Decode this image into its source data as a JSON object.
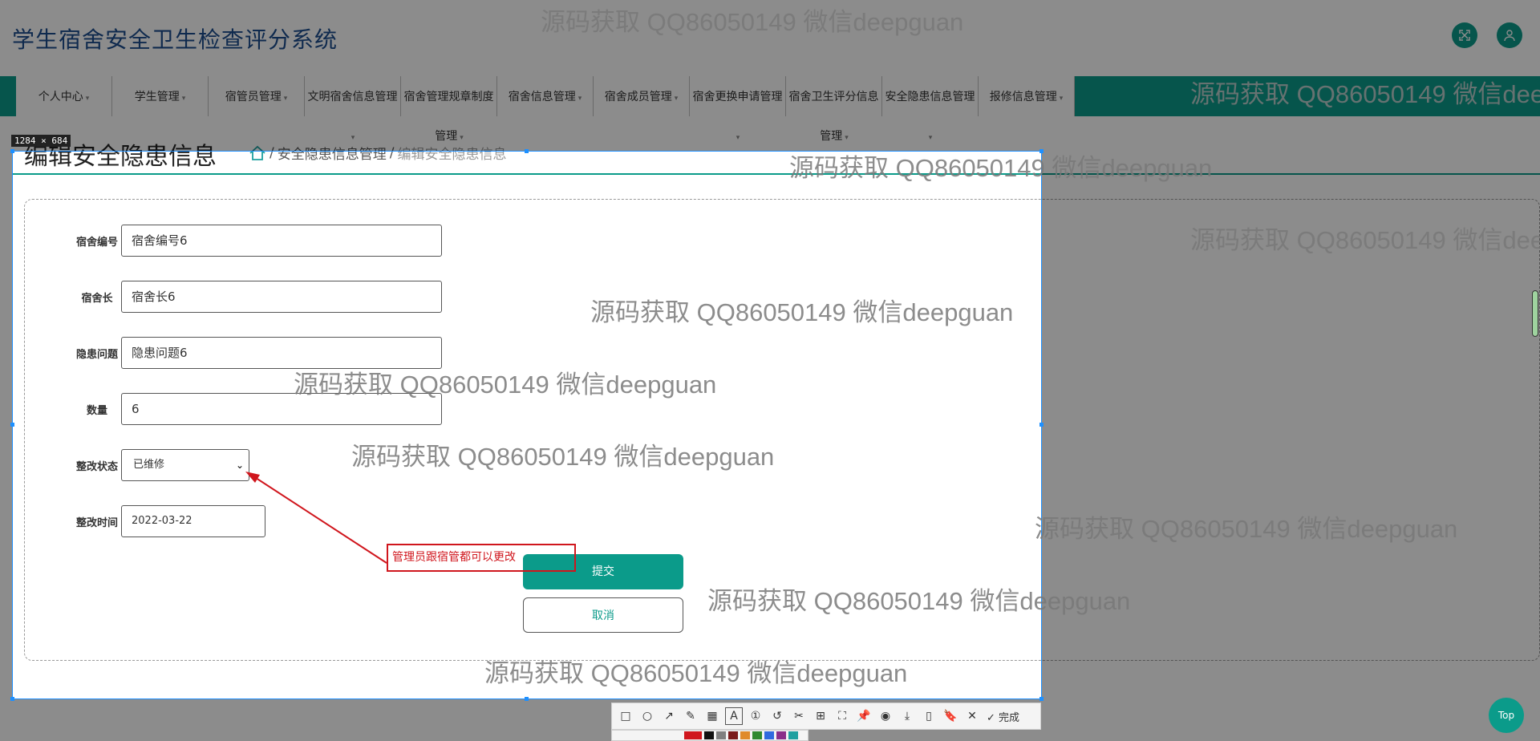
{
  "header": {
    "title": "学生宿舍安全卫生检查评分系统",
    "icons": [
      "fullscreen-icon",
      "user-icon"
    ]
  },
  "nav": {
    "items": [
      {
        "label": "个人中心",
        "sub": ""
      },
      {
        "label": "学生管理",
        "sub": ""
      },
      {
        "label": "宿管员管理",
        "sub": ""
      },
      {
        "label": "文明宿舍信息管理",
        "sub": ""
      },
      {
        "label": "宿舍管理规章制度",
        "sub": "管理"
      },
      {
        "label": "宿舍信息管理",
        "sub": ""
      },
      {
        "label": "宿舍成员管理",
        "sub": ""
      },
      {
        "label": "宿舍更换申请管理",
        "sub": ""
      },
      {
        "label": "宿舍卫生评分信息",
        "sub": "管理"
      },
      {
        "label": "安全隐患信息管理",
        "sub": ""
      },
      {
        "label": "报修信息管理",
        "sub": ""
      }
    ]
  },
  "page": {
    "title": "编辑安全隐患信息",
    "breadcrumb": [
      "安全隐患信息管理",
      "编辑安全隐患信息"
    ]
  },
  "form": {
    "fields": [
      {
        "label": "宿舍编号",
        "value": "宿舍编号6"
      },
      {
        "label": "宿舍长",
        "value": "宿舍长6"
      },
      {
        "label": "隐患问题",
        "value": "隐患问题6"
      },
      {
        "label": "数量",
        "value": "6"
      }
    ],
    "status": {
      "label": "整改状态",
      "value": "已维修"
    },
    "date": {
      "label": "整改时间",
      "value": "2022-03-22"
    },
    "submit_label": "提交",
    "cancel_label": "取消"
  },
  "overlay": {
    "size_label": "1284 × 684",
    "annotation": "管理员跟宿管都可以更改",
    "done_label": "完成",
    "annotation_color": "#d0161d",
    "palette": [
      "#d0161d",
      "#111111",
      "#808080",
      "#7b1a1a",
      "#e08a2a",
      "#2f8a2f",
      "#2f6adf",
      "#8a2f8a",
      "#1fa0a0"
    ]
  },
  "misc": {
    "top_label": "Top"
  },
  "watermark": "源码获取 QQ86050149 微信deepguan",
  "colors": {
    "primary": "#0b9b8a",
    "title": "#1d4e8f"
  }
}
